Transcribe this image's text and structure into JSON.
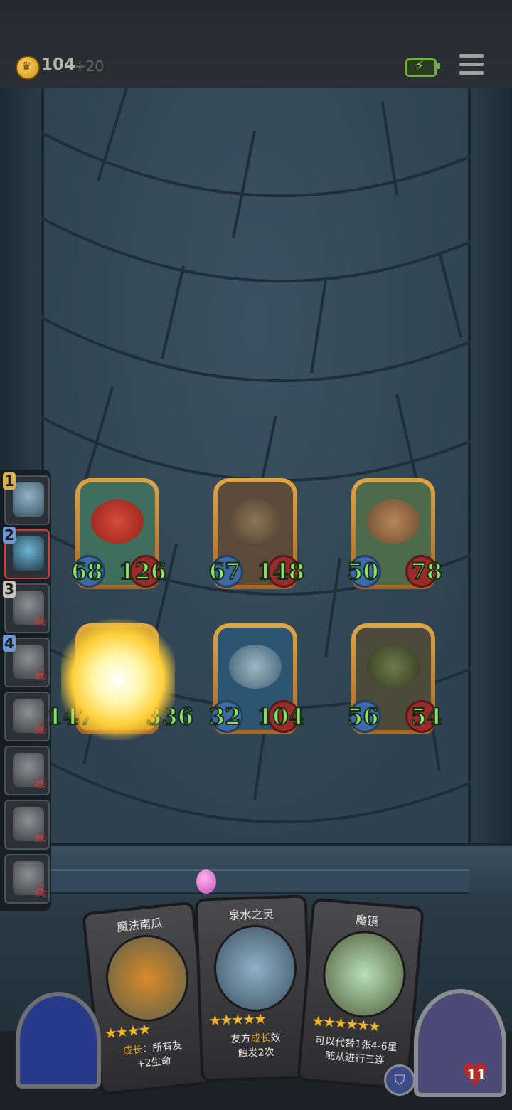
{
  "top_bar": {
    "gold": "104",
    "gold_income": "+20",
    "icons": [
      "coin-icon",
      "battery-icon",
      "menu-icon"
    ]
  },
  "queue": [
    {
      "label": "1",
      "active": false,
      "defeated": false
    },
    {
      "label": "2",
      "active": true,
      "defeated": false
    },
    {
      "label": "3",
      "active": false,
      "defeated": true
    },
    {
      "label": "4",
      "active": false,
      "defeated": true
    },
    {
      "label": "",
      "active": false,
      "defeated": true
    },
    {
      "label": "",
      "active": false,
      "defeated": true
    },
    {
      "label": "",
      "active": false,
      "defeated": true
    },
    {
      "label": "",
      "active": false,
      "defeated": true
    }
  ],
  "board": [
    {
      "attack": "68",
      "health": "126"
    },
    {
      "attack": "67",
      "health": "148"
    },
    {
      "attack": "50",
      "health": "78"
    },
    {
      "attack": "147",
      "health": "336"
    },
    {
      "attack": "32",
      "health": "104"
    },
    {
      "attack": "56",
      "health": "54"
    }
  ],
  "hand": [
    {
      "title": "魔法南瓜",
      "desc_highlight": "成长",
      "desc_rest": "：所有友",
      "desc_line2": "+2生命"
    },
    {
      "title": "泉水之灵",
      "desc_prefix": "友方",
      "desc_highlight": "成长",
      "desc_rest": "效",
      "desc_line2": "触发2次"
    },
    {
      "title": "魔镜",
      "desc_line1": "可以代替1张4-6星",
      "desc_line2": "随从进行三连"
    }
  ],
  "player": {
    "health": "11"
  },
  "colors": {
    "stat_green": "#86e26a",
    "gold_frame": "#e0a544",
    "defeated_red": "#e03b3b"
  }
}
